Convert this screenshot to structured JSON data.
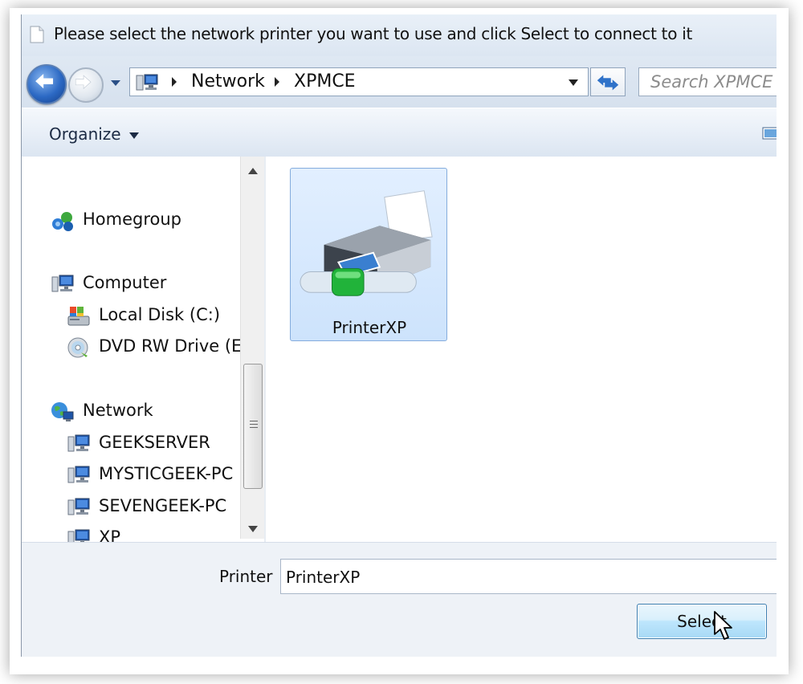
{
  "window": {
    "title": "Please select the network printer you want to use and click Select to connect to it"
  },
  "address_bar": {
    "segments": [
      "Network",
      "XPMCE"
    ]
  },
  "search": {
    "placeholder": "Search XPMCE"
  },
  "toolbar": {
    "organize_label": "Organize"
  },
  "nav_pane": {
    "groups": [
      {
        "label": "Homegroup",
        "icon": "homegroup-icon",
        "items": []
      },
      {
        "label": "Computer",
        "icon": "computer-icon",
        "items": [
          {
            "label": "Local Disk (C:)",
            "icon": "local-disk-icon"
          },
          {
            "label": "DVD RW Drive (E:)",
            "icon": "dvd-drive-icon"
          }
        ]
      },
      {
        "label": "Network",
        "icon": "network-icon",
        "items": [
          {
            "label": "GEEKSERVER",
            "icon": "network-computer-icon"
          },
          {
            "label": "MYSTICGEEK-PC",
            "icon": "network-computer-icon"
          },
          {
            "label": "SEVENGEEK-PC",
            "icon": "network-computer-icon"
          },
          {
            "label": "XP",
            "icon": "network-computer-icon"
          }
        ]
      }
    ]
  },
  "content": {
    "items": [
      {
        "label": "PrinterXP",
        "icon": "network-printer-icon",
        "selected": true
      }
    ]
  },
  "footer": {
    "printer_label": "Printer",
    "printer_value": "PrinterXP",
    "select_label": "Select"
  },
  "colors": {
    "selection_fill": "#cde3fc",
    "selection_border": "#84acdd",
    "button_border": "#3c7fb1"
  }
}
